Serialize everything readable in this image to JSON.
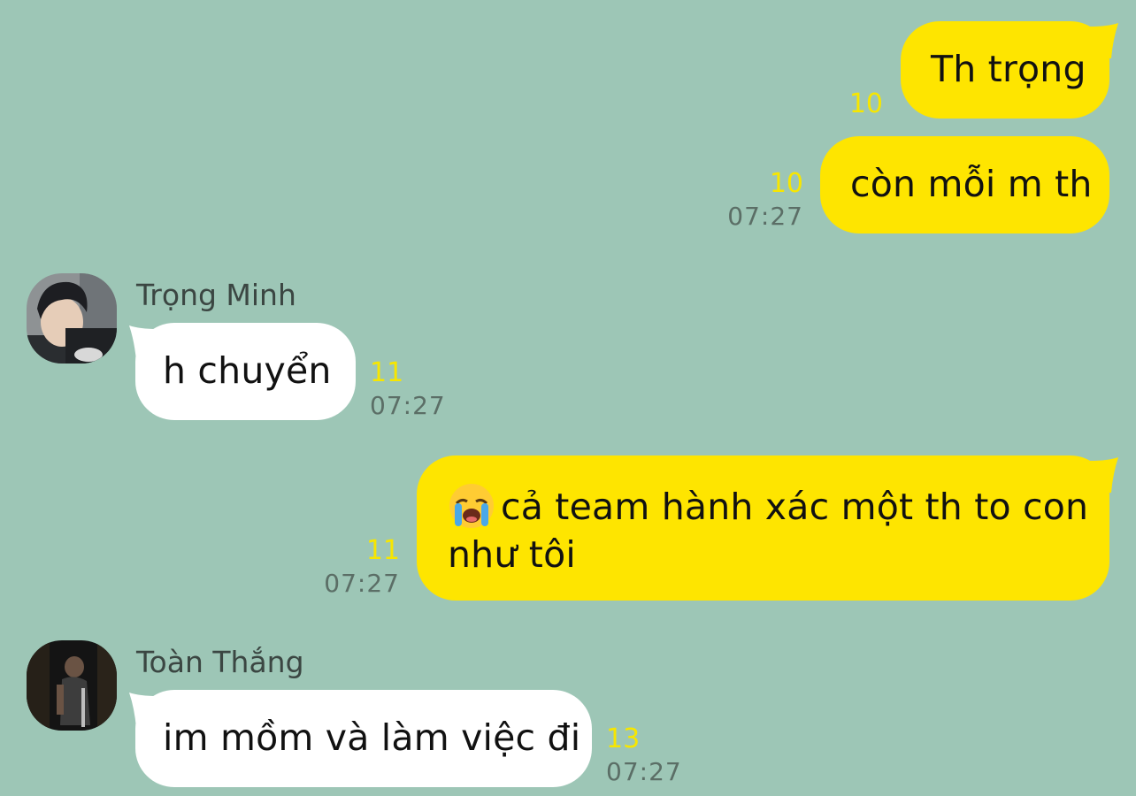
{
  "messages": [
    {
      "id": "m1",
      "direction": "sent",
      "text": "Th trọng",
      "unread": "10",
      "time": ""
    },
    {
      "id": "m2",
      "direction": "sent",
      "text": "còn mỗi m th",
      "unread": "10",
      "time": "07:27"
    },
    {
      "id": "m3",
      "direction": "received",
      "sender": "Trọng Minh",
      "text": "h chuyển",
      "unread": "11",
      "time": "07:27"
    },
    {
      "id": "m4",
      "direction": "sent",
      "emoji": "loudly-crying-face",
      "line1": "cả team hành xác một th to con",
      "line2": "như tôi",
      "unread": "11",
      "time": "07:27"
    },
    {
      "id": "m5",
      "direction": "received",
      "sender": "Toàn Thắng",
      "text": "im mồm và làm việc đi",
      "unread": "13",
      "time": "07:27"
    }
  ],
  "colors": {
    "background": "#9dc6b6",
    "sent_bubble": "#fee500",
    "received_bubble": "#ffffff",
    "unread_count": "#f7e600",
    "timestamp": "#5b6e66",
    "sender_name": "#3b4642"
  }
}
